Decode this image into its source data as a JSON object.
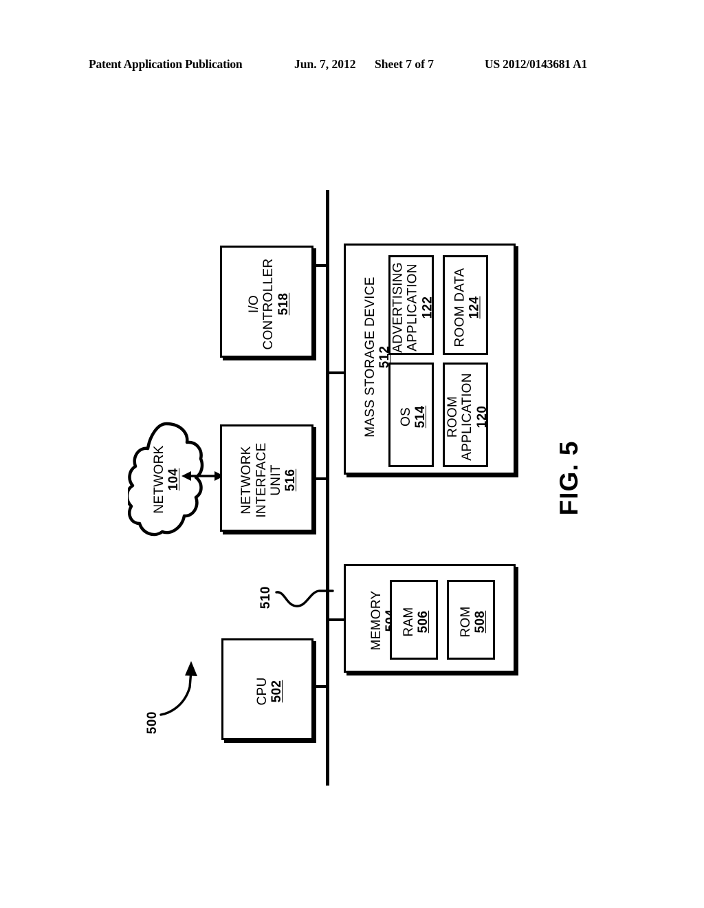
{
  "header": {
    "publication": "Patent Application Publication",
    "date": "Jun. 7, 2012",
    "sheet": "Sheet 7 of 7",
    "patent_number": "US 2012/0143681 A1"
  },
  "figure": {
    "label": "FIG. 5",
    "system_ref": "500",
    "bus_ref": "510"
  },
  "blocks": {
    "cpu": {
      "title": "CPU",
      "ref": "502"
    },
    "memory": {
      "title": "MEMORY",
      "ref": "504"
    },
    "ram": {
      "title": "RAM",
      "ref": "506"
    },
    "rom": {
      "title": "ROM",
      "ref": "508"
    },
    "mass_storage": {
      "title": "MASS STORAGE DEVICE",
      "ref": "512"
    },
    "os": {
      "title": "OS",
      "ref": "514"
    },
    "advertising_application": {
      "title_line1": "ADVERTISING",
      "title_line2": "APPLICATION",
      "ref": "122"
    },
    "room_data": {
      "title": "ROOM DATA",
      "ref": "124"
    },
    "room_application": {
      "title_line1": "ROOM",
      "title_line2": "APPLICATION",
      "ref": "120"
    },
    "network_interface_unit": {
      "title_line1": "NETWORK",
      "title_line2": "INTERFACE",
      "title_line3": "UNIT",
      "ref": "516"
    },
    "io_controller": {
      "title_line1": "I/O",
      "title_line2": "CONTROLLER",
      "ref": "518"
    },
    "network": {
      "title": "NETWORK",
      "ref": "104"
    }
  },
  "colors": {
    "ink": "#000000",
    "paper": "#ffffff"
  }
}
